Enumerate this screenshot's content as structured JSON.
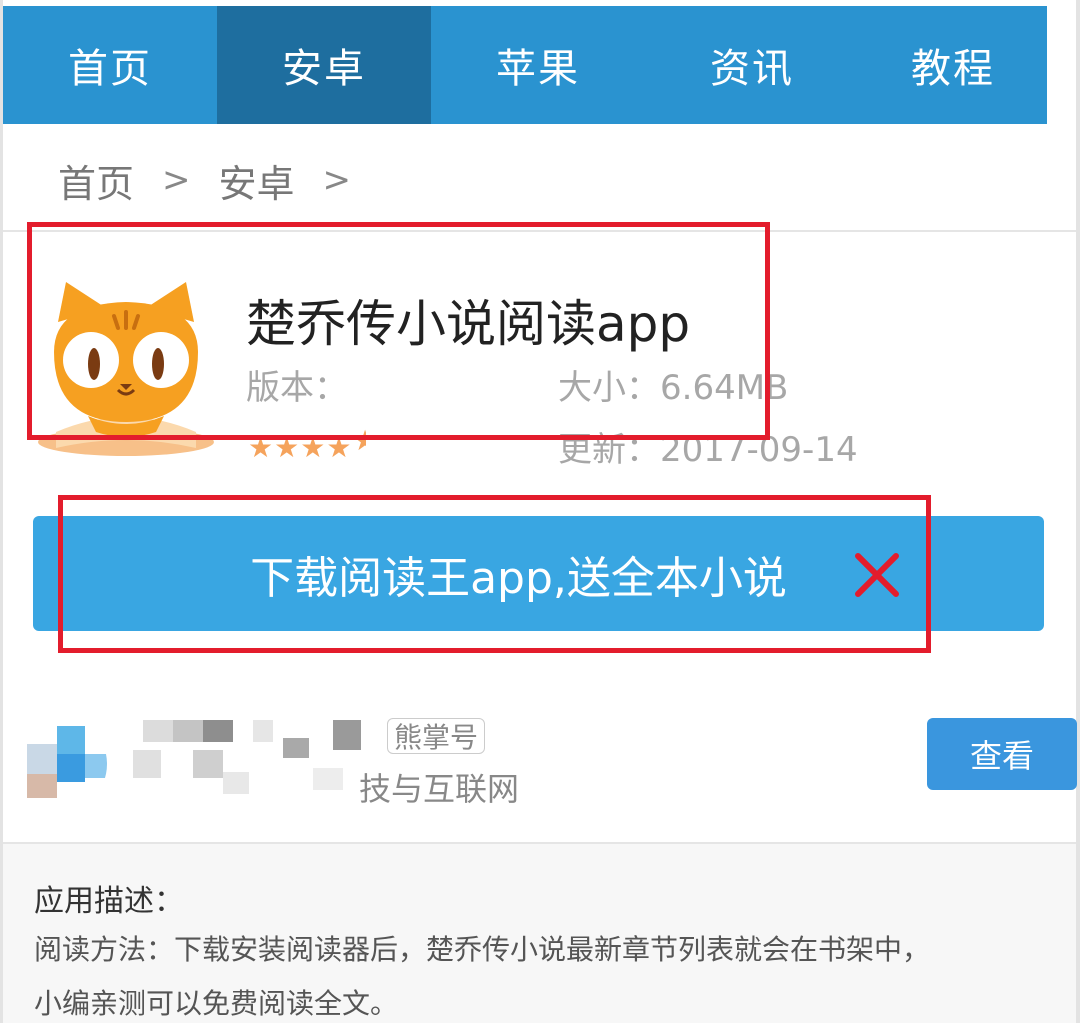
{
  "nav": {
    "items": [
      {
        "label": "首页"
      },
      {
        "label": "安卓"
      },
      {
        "label": "苹果"
      },
      {
        "label": "资讯"
      },
      {
        "label": "教程"
      }
    ],
    "active": "安卓"
  },
  "breadcrumb": {
    "items": [
      "首页",
      "安卓"
    ],
    "separator": ">"
  },
  "app": {
    "title": "楚乔传小说阅读app",
    "version_label": "版本：",
    "size_label": "大小：6.64MB",
    "updated_label": "更新：2017-09-14",
    "rating_stars": 4.5,
    "icon": "cat-app-icon"
  },
  "download": {
    "label": "下载阅读王app,送全本小说",
    "close_icon": "close-icon"
  },
  "author": {
    "badge": "熊掌号",
    "description": "技与互联网",
    "view_button": "查看"
  },
  "description": {
    "title": "应用描述：",
    "line1": "阅读方法：下载安装阅读器后，楚乔传小说最新章节列表就会在书架中，",
    "line2": "小编亲测可以免费阅读全文。"
  },
  "colors": {
    "nav_bg": "#2a93d0",
    "nav_active": "#1e6e9f",
    "download_bg": "#39a6e2",
    "highlight_red": "#e31c2c",
    "star_color": "#f5a35c"
  }
}
